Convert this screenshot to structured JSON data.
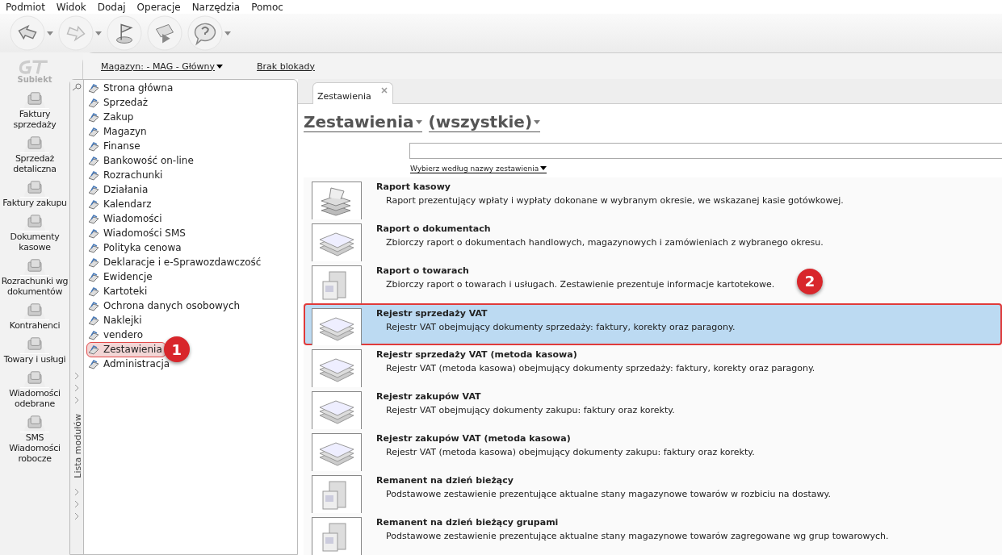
{
  "menu": [
    "Podmiot",
    "Widok",
    "Dodaj",
    "Operacje",
    "Narzędzia",
    "Pomoc"
  ],
  "toolbar": [
    {
      "kind": "back",
      "has_dropdown": true
    },
    {
      "kind": "forward",
      "has_dropdown": true
    },
    {
      "kind": "flag",
      "has_dropdown": false
    },
    {
      "kind": "check",
      "has_dropdown": false
    },
    {
      "kind": "help",
      "has_dropdown": true
    }
  ],
  "brand": "Subiekt",
  "nav": [
    "Faktury sprzedaży",
    "Sprzedaż detaliczna",
    "Faktury zakupu",
    "Dokumenty kasowe",
    "Rozrachunki wg dokumentów",
    "Kontrahenci",
    "Towary i usługi",
    "Wiadomości odebrane",
    "SMS Wiadomości robocze"
  ],
  "location": {
    "warehouse": "Magazyn: - MAG - Główny",
    "lock": "Brak blokady"
  },
  "modules": {
    "strip_label": "Lista modułów",
    "items": [
      {
        "label": "Strona główna",
        "selected": false
      },
      {
        "label": "Sprzedaż",
        "selected": false
      },
      {
        "label": "Zakup",
        "selected": false
      },
      {
        "label": "Magazyn",
        "selected": false
      },
      {
        "label": "Finanse",
        "selected": false
      },
      {
        "label": "Bankowość on-line",
        "selected": false
      },
      {
        "label": "Rozrachunki",
        "selected": false
      },
      {
        "label": "Działania",
        "selected": false
      },
      {
        "label": "Kalendarz",
        "selected": false
      },
      {
        "label": "Wiadomości",
        "selected": false
      },
      {
        "label": "Wiadomości SMS",
        "selected": false
      },
      {
        "label": "Polityka cenowa",
        "selected": false
      },
      {
        "label": "Deklaracje i e-Sprawozdawczość",
        "selected": false
      },
      {
        "label": "Ewidencje",
        "selected": false
      },
      {
        "label": "Kartoteki",
        "selected": false
      },
      {
        "label": "Ochrona danych osobowych",
        "selected": false
      },
      {
        "label": "Naklejki",
        "selected": false
      },
      {
        "label": "vendero",
        "selected": false
      },
      {
        "label": "Zestawienia",
        "selected": true,
        "callout": "1"
      },
      {
        "label": "Administracja",
        "selected": false
      }
    ]
  },
  "tabs": [
    {
      "label": "Zestawienia",
      "selected": true
    }
  ],
  "header": {
    "category": "Zestawienia",
    "filter": "(wszystkie)"
  },
  "sort_link": "Wybierz według nazwy zestawienia",
  "reports": [
    {
      "title": "Raport kasowy",
      "description": "Raport prezentujący wpłaty i wypłaty dokonane w wybranym okresie, we wskazanej kasie gotówkowej.",
      "kind": "cash",
      "selected": false
    },
    {
      "title": "Raport o dokumentach",
      "description": "Zbiorczy raport o dokumentach handlowych, magazynowych i zamówieniach z wybranego okresu.",
      "kind": "sheets",
      "selected": false
    },
    {
      "title": "Raport o towarach",
      "description": "Zbiorczy raport o towarach i usługach. Zestawienie prezentuje informacje kartotekowe.",
      "kind": "boxes",
      "selected": false,
      "callout": "2"
    },
    {
      "title": "Rejestr sprzedaży VAT",
      "description": "Rejestr VAT obejmujący dokumenty sprzedaży: faktury, korekty oraz paragony.",
      "kind": "sheets",
      "selected": true
    },
    {
      "title": "Rejestr sprzedaży VAT (metoda kasowa)",
      "description": "Rejestr VAT (metoda kasowa) obejmujący dokumenty sprzedaży: faktury, korekty oraz paragony.",
      "kind": "sheets",
      "selected": false
    },
    {
      "title": "Rejestr zakupów VAT",
      "description": "Rejestr VAT obejmujący dokumenty zakupu: faktury oraz korekty.",
      "kind": "sheets",
      "selected": false
    },
    {
      "title": "Rejestr zakupów VAT (metoda kasowa)",
      "description": "Rejestr VAT (metoda kasowa) obejmujący dokumenty zakupu: faktury oraz korekty.",
      "kind": "sheets",
      "selected": false
    },
    {
      "title": "Remanent na dzień bieżący",
      "description": "Podstawowe zestawienie prezentujące aktualne stany magazynowe towarów w rozbiciu na dostawy.",
      "kind": "boxes",
      "selected": false
    },
    {
      "title": "Remanent na dzień bieżący grupami",
      "description": "Podstawowe zestawienie prezentujące aktualne stany magazynowe towarów zagregowane wg grup towarowych.",
      "kind": "boxes",
      "selected": false
    }
  ]
}
